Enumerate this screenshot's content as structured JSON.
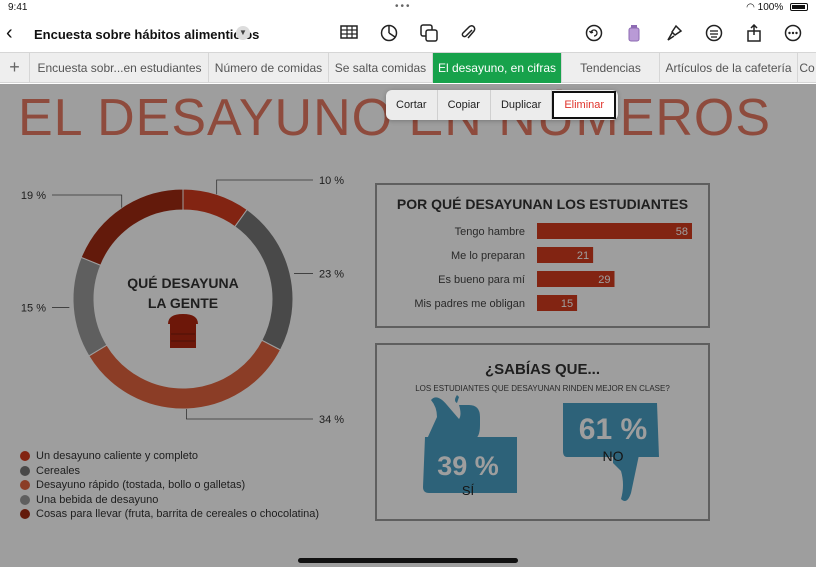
{
  "status": {
    "time": "9:41",
    "battery": "100%"
  },
  "document": {
    "title": "Encuesta sobre hábitos alimenticios"
  },
  "toolbar_icons": [
    "table-icon",
    "chart-icon",
    "shapes-icon",
    "attachment-icon",
    "undo-icon",
    "format-icon",
    "brush-icon",
    "list-icon",
    "share-icon",
    "more-icon"
  ],
  "tabs": [
    {
      "label": "Encuesta sobr...en estudiantes"
    },
    {
      "label": "Número de comidas"
    },
    {
      "label": "Se salta comidas"
    },
    {
      "label": "El desayuno, en cifras"
    },
    {
      "label": "Tendencias"
    },
    {
      "label": "Artículos de la cafetería"
    },
    {
      "label": "Co"
    }
  ],
  "edit_menu": {
    "cut": "Cortar",
    "copy": "Copiar",
    "duplicate": "Duplicar",
    "delete": "Eliminar"
  },
  "page": {
    "title": "EL DESAYUNO EN NÚMEROS"
  },
  "chart_data": [
    {
      "type": "pie",
      "title": "QUÉ DESAYUNA LA GENTE",
      "categories": [
        "Un desayuno caliente y completo",
        "Cereales",
        "Desayuno rápido (tostada, bollo o galletas)",
        "Una bebida de desayuno",
        "Cosas para llevar (fruta, barrita de cereales o chocolatina)"
      ],
      "values": [
        10,
        23,
        34,
        15,
        19
      ],
      "value_labels": [
        "10 %",
        "23 %",
        "34 %",
        "15 %",
        "19 %"
      ],
      "colors": [
        "#d23a1e",
        "#777777",
        "#e0633e",
        "#9a9a9a",
        "#a12a13"
      ],
      "legend": "bottom-left"
    },
    {
      "type": "bar",
      "orientation": "horizontal",
      "title": "POR QUÉ DESAYUNAN LOS ESTUDIANTES",
      "categories": [
        "Tengo hambre",
        "Me lo preparan",
        "Es bueno para mí",
        "Mis padres me obligan"
      ],
      "values": [
        58,
        21,
        29,
        15
      ],
      "xlim": [
        0,
        58
      ],
      "color": "#d23a1e"
    }
  ],
  "did_you_know": {
    "title": "¿SABÍAS QUE...",
    "subtitle": "LOS ESTUDIANTES QUE DESAYUNAN RINDEN MEJOR EN CLASE?",
    "yes_value": "39 %",
    "yes_label": "SÍ",
    "no_value": "61 %",
    "no_label": "NO",
    "thumb_color": "#4a9fc3"
  }
}
